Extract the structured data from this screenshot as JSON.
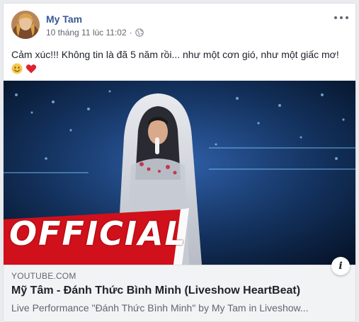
{
  "post": {
    "author": "My Tam",
    "timestamp": "10 tháng 11 lúc 11:02",
    "separator": "·",
    "privacy_icon": "globe-icon",
    "text": "Cảm xúc!!! Không tin là đã 5 năm rồi... như một cơn gió, như một giấc mơ!",
    "emojis": [
      "smiling-face-emoji",
      "red-heart-emoji"
    ]
  },
  "media": {
    "overlay_text": "OFFICIAL",
    "accent_red": "#d0101a"
  },
  "link": {
    "domain": "YOUTUBE.COM",
    "title": "Mỹ Tâm - Đánh Thức Bình Minh (Liveshow HeartBeat)",
    "description": "Live Performance \"Đánh Thức Bình Minh\" by My Tam in Liveshow..."
  },
  "colors": {
    "name_link": "#385898",
    "meta_text": "#616770",
    "body_text": "#1d2129",
    "link_box_bg": "#f2f3f5"
  }
}
